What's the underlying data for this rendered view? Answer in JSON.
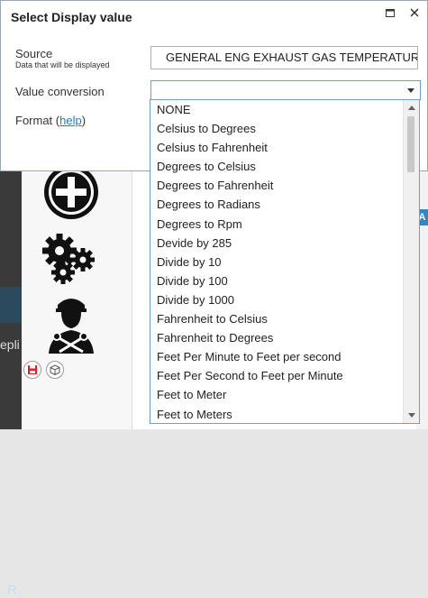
{
  "dialog": {
    "title": "Select Display value",
    "source_label": "Source",
    "source_sub": "Data that will be displayed",
    "source_value": "GENERAL ENG EXHAUST GAS TEMPERATURE:",
    "conversion_label": "Value conversion",
    "conversion_value": "",
    "format_prefix": "Format (",
    "format_link": "help",
    "format_suffix": ")"
  },
  "dropdown": {
    "options": [
      "NONE",
      "Celsius to Degrees",
      "Celsius to Fahrenheit",
      "Degrees to Celsius",
      "Degrees to Fahrenheit",
      "Degrees to Radians",
      "Degrees to Rpm",
      "Devide by 285",
      "Divide by 10",
      "Divide by 100",
      "Divide by 1000",
      "Fahrenheit to Celsius",
      "Fahrenheit to Degrees",
      "Feet Per Minute to Feet per second",
      "Feet Per Second to Feet per Minute",
      "Feet to Meter",
      "Feet to Meters"
    ]
  },
  "background": {
    "left_tab_text": "R",
    "left_text": "epli",
    "chip_text": "A"
  },
  "colors": {
    "accent": "#1b7fc4",
    "border_focus": "#6d9ed0"
  }
}
